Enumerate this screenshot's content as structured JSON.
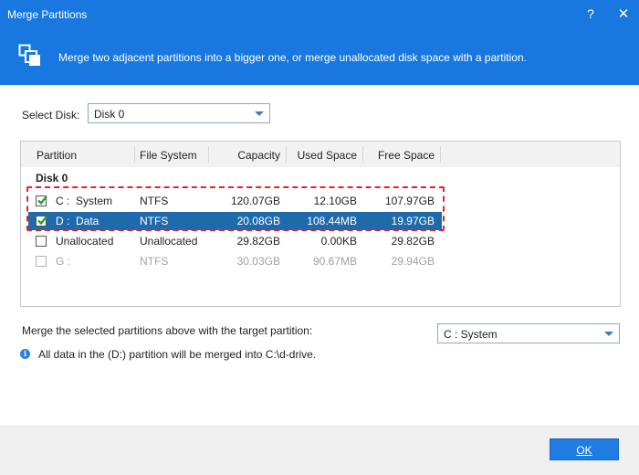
{
  "window": {
    "title": "Merge Partitions",
    "help_glyph": "?",
    "close_glyph": "✕"
  },
  "banner": {
    "text": "Merge two adjacent partitions into a bigger one, or merge unallocated disk space with a partition.",
    "icon": "merge-partitions-icon"
  },
  "select_disk": {
    "label": "Select Disk:",
    "value": "Disk 0"
  },
  "table": {
    "columns": {
      "partition": "Partition",
      "file_system": "File System",
      "capacity": "Capacity",
      "used": "Used Space",
      "free": "Free Space"
    },
    "disk_label": "Disk 0",
    "rows": [
      {
        "name": "C :  System",
        "fs": "NTFS",
        "capacity": "120.07GB",
        "used": "12.10GB",
        "free": "107.97GB",
        "checked": true,
        "selected": false,
        "disabled": false
      },
      {
        "name": "D :  Data",
        "fs": "NTFS",
        "capacity": "20.08GB",
        "used": "108.44MB",
        "free": "19.97GB",
        "checked": true,
        "selected": true,
        "disabled": false
      },
      {
        "name": "Unallocated",
        "fs": "Unallocated",
        "capacity": "29.82GB",
        "used": "0.00KB",
        "free": "29.82GB",
        "checked": false,
        "selected": false,
        "disabled": false
      },
      {
        "name": "G :",
        "fs": "NTFS",
        "capacity": "30.03GB",
        "used": "90.67MB",
        "free": "29.94GB",
        "checked": false,
        "selected": false,
        "disabled": true
      }
    ]
  },
  "merge": {
    "label": "Merge the selected partitions above with the target partition:",
    "target_value": "C :  System"
  },
  "info": {
    "text": "All data in the (D:) partition will be merged into C:\\d-drive.",
    "icon_glyph": "i"
  },
  "footer": {
    "ok_label": "OK"
  },
  "colors": {
    "title_bar": "#1878e0",
    "selected_row": "#1f6aaa",
    "highlight_dash": "#e0242a",
    "ok_button": "#1f7ce0"
  }
}
